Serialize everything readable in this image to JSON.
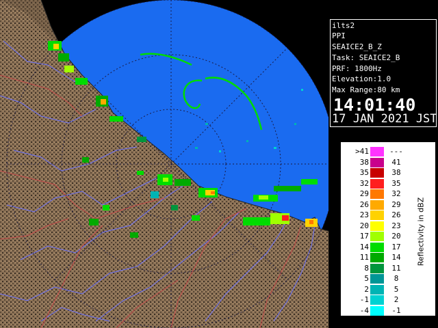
{
  "map": {
    "colors": {
      "sea": "#1a6bf0",
      "outside": "#000000",
      "land": "#8b7156",
      "land_dark": "#3c3024",
      "rivers": "#6d74ff",
      "boundaries": "#c74a4a",
      "range_rings": "#1b1b44"
    }
  },
  "info": {
    "site": "ilts2",
    "scan_type": "PPI",
    "product": "SEAICE2_B_Z",
    "task": "Task: SEAICE2_B",
    "prf": "PRF: 1800Hz",
    "elevation": "Elevation:1.0",
    "max_range": "Max Range:80 km",
    "time": "14:01:40",
    "date": "17 JAN 2021 JST"
  },
  "legend": {
    "title": "Reflectivity in dBZ",
    "rows": [
      {
        "lo": ">41",
        "hi": "---",
        "color": "#ff33ff"
      },
      {
        "lo": "38",
        "hi": "41",
        "color": "#c8008c"
      },
      {
        "lo": "35",
        "hi": "38",
        "color": "#c80000"
      },
      {
        "lo": "32",
        "hi": "35",
        "color": "#ff1e1e"
      },
      {
        "lo": "29",
        "hi": "32",
        "color": "#ff7800"
      },
      {
        "lo": "26",
        "hi": "29",
        "color": "#ffaa00"
      },
      {
        "lo": "23",
        "hi": "26",
        "color": "#ffd200"
      },
      {
        "lo": "20",
        "hi": "23",
        "color": "#ffff00"
      },
      {
        "lo": "17",
        "hi": "20",
        "color": "#a0ff00"
      },
      {
        "lo": "14",
        "hi": "17",
        "color": "#00dc00"
      },
      {
        "lo": "11",
        "hi": "14",
        "color": "#00aa00"
      },
      {
        "lo": "8",
        "hi": "11",
        "color": "#00963c"
      },
      {
        "lo": "5",
        "hi": "8",
        "color": "#009696"
      },
      {
        "lo": "2",
        "hi": "5",
        "color": "#00b4b4"
      },
      {
        "lo": "-1",
        "hi": "2",
        "color": "#00d2d2"
      },
      {
        "lo": "-4",
        "hi": "-1",
        "color": "#00ffff"
      }
    ]
  }
}
